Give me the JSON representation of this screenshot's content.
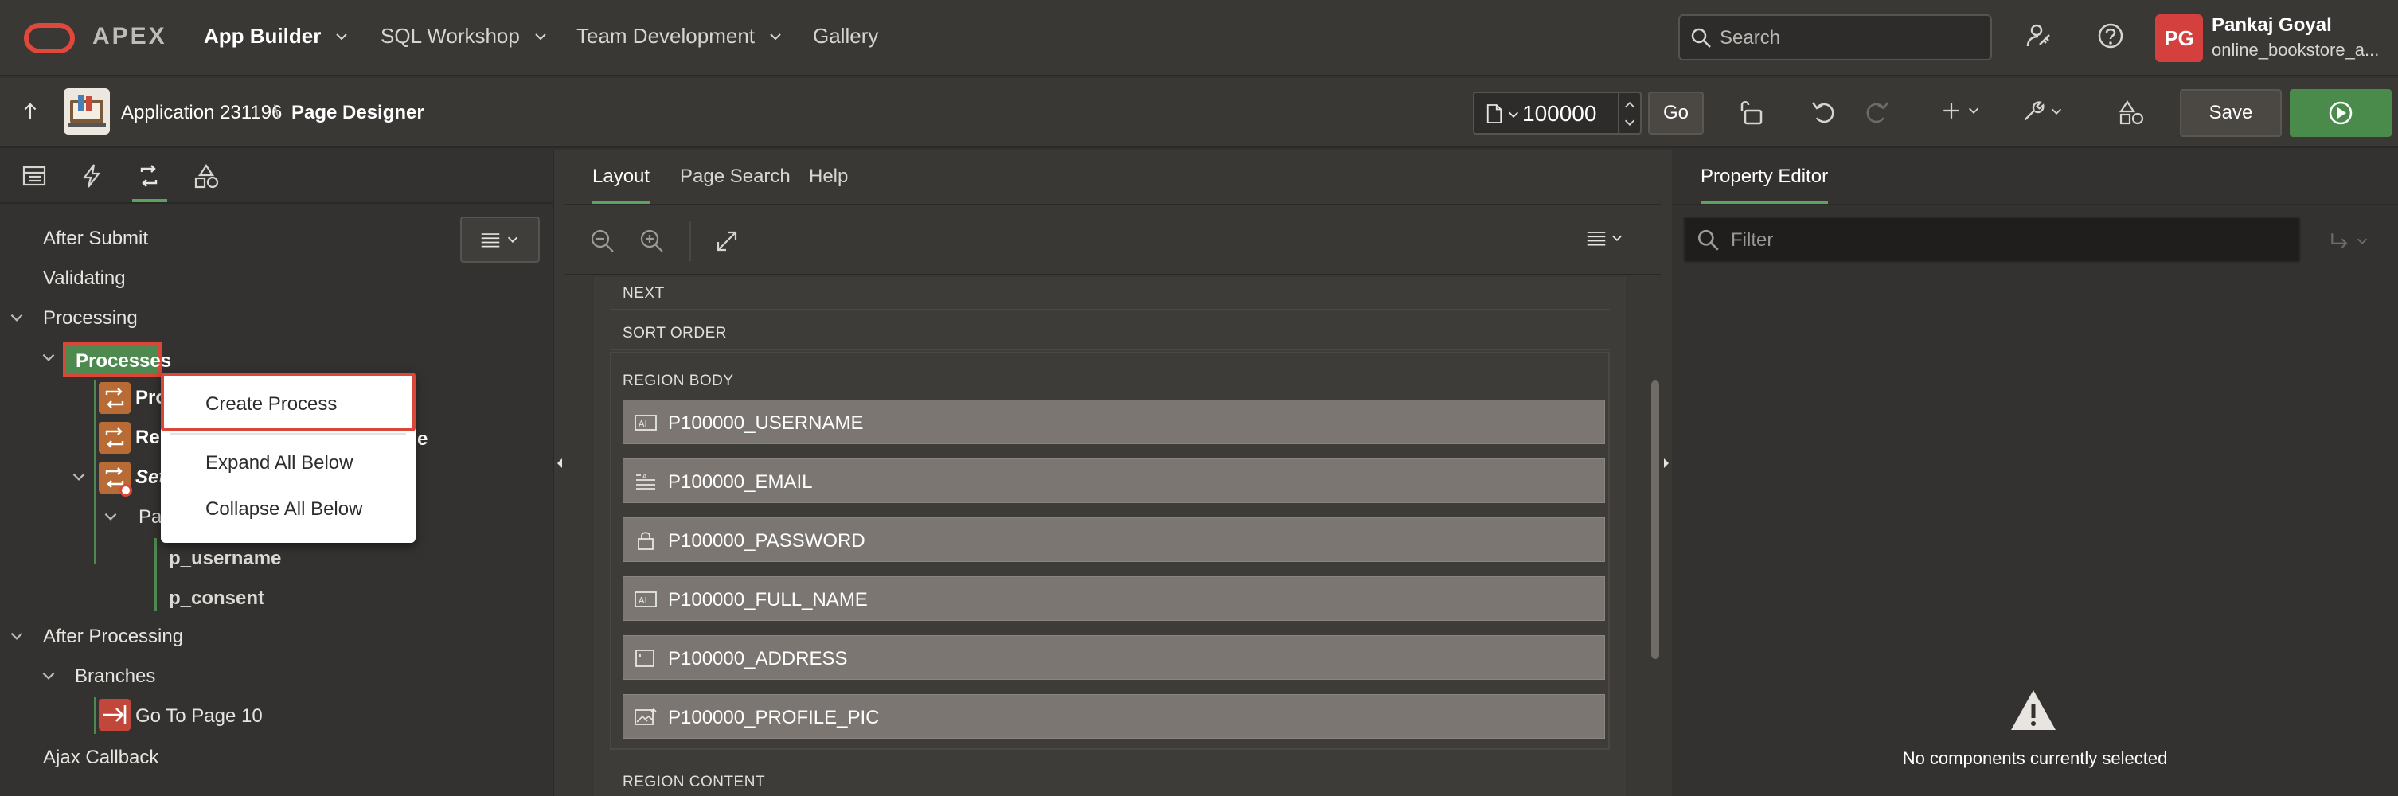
{
  "topbar": {
    "brand": "APEX",
    "nav": [
      "App Builder",
      "SQL Workshop",
      "Team Development",
      "Gallery"
    ],
    "search_placeholder": "Search",
    "user_initials": "PG",
    "user_name": "Pankaj Goyal",
    "user_workspace": "online_bookstore_a..."
  },
  "toolbar": {
    "app_label": "Application 231196",
    "separator": "\\",
    "page_label": "Page Designer",
    "page_number": "100000",
    "go_label": "Go",
    "save_label": "Save"
  },
  "left": {
    "tree": {
      "after_submit": "After Submit",
      "validating": "Validating",
      "processing": "Processing",
      "processes": "Processes",
      "proc1": "Pro",
      "proc2": "Ren",
      "proc2_tail": "e",
      "proc3": "Set",
      "params": "Pa",
      "param1": "p_username",
      "param2": "p_consent",
      "after_processing": "After Processing",
      "branches": "Branches",
      "branch1": "Go To Page 10",
      "ajax": "Ajax Callback"
    },
    "context_menu": [
      "Create Process",
      "Expand All Below",
      "Collapse All Below"
    ]
  },
  "center": {
    "tabs": [
      "Layout",
      "Page Search",
      "Help"
    ],
    "sections": {
      "next": "NEXT",
      "sort_order": "SORT ORDER",
      "region_body": "REGION BODY",
      "region_content": "REGION CONTENT"
    },
    "items": [
      {
        "name": "P100000_USERNAME",
        "icon": "text-field-icon"
      },
      {
        "name": "P100000_EMAIL",
        "icon": "textarea-icon"
      },
      {
        "name": "P100000_PASSWORD",
        "icon": "lock-icon"
      },
      {
        "name": "P100000_FULL_NAME",
        "icon": "text-field-icon"
      },
      {
        "name": "P100000_ADDRESS",
        "icon": "input-box-icon"
      },
      {
        "name": "P100000_PROFILE_PIC",
        "icon": "image-upload-icon"
      }
    ]
  },
  "right": {
    "tab": "Property Editor",
    "filter_placeholder": "Filter",
    "empty_message": "No components currently selected"
  }
}
